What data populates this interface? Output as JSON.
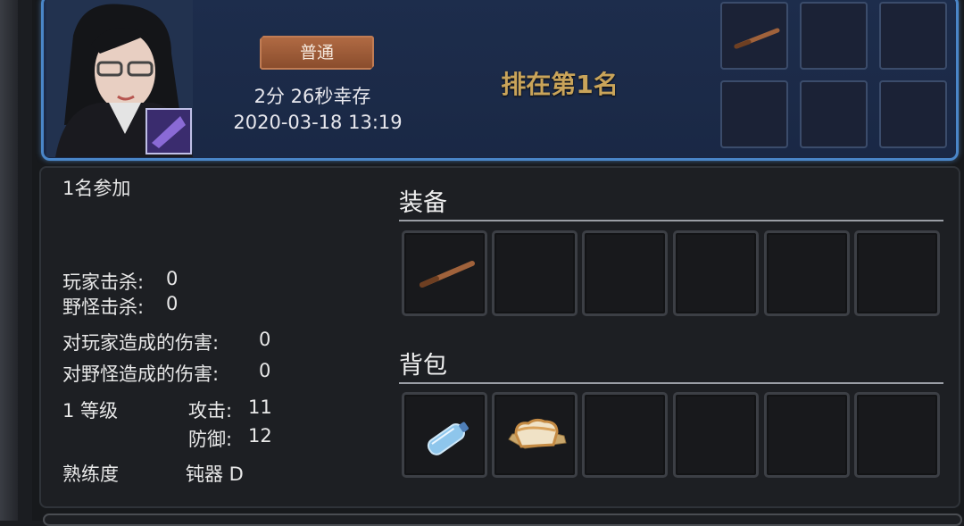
{
  "header": {
    "mode_badge": "普通",
    "survival_time": "2分 26秒幸存",
    "datetime": "2020-03-18 13:19",
    "rank_text": "排在第1名",
    "top_slots": [
      "wooden-bat-icon",
      "",
      "",
      "",
      "",
      ""
    ]
  },
  "stats": {
    "participants": "1名参加",
    "player_kills_label": "玩家击杀:",
    "player_kills": "0",
    "monster_kills_label": "野怪击杀:",
    "monster_kills": "0",
    "player_damage_label": "对玩家造成的伤害:",
    "player_damage": "0",
    "monster_damage_label": "对野怪造成的伤害:",
    "monster_damage": "0",
    "level": "1 等级",
    "attack_label": "攻击:",
    "attack": "11",
    "defense_label": "防御:",
    "defense": "12",
    "proficiency_label": "熟练度",
    "proficiency_weapon": "钝器 D"
  },
  "equipment": {
    "title": "装备",
    "slots": [
      "wooden-bat-icon",
      "",
      "",
      "",
      "",
      ""
    ]
  },
  "backpack": {
    "title": "背包",
    "slots": [
      "water-bottle-icon",
      "bread-icon",
      "",
      "",
      "",
      ""
    ]
  },
  "colors": {
    "card_border": "#4a86c8",
    "card_bg": "#1d2d4c",
    "rank_gold": "#c9a45a",
    "badge_bg": "#9c5a37"
  }
}
